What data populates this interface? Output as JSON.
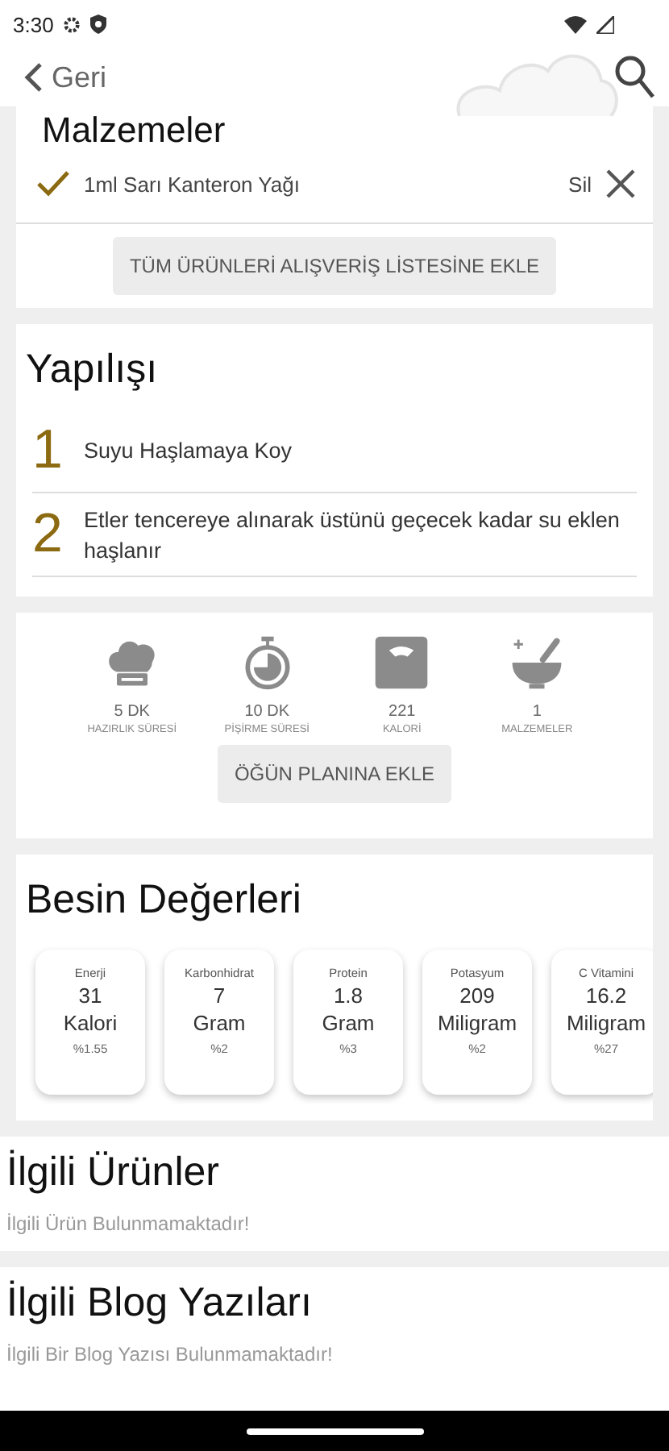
{
  "status_bar": {
    "time": "3:30"
  },
  "header": {
    "back_label": "Geri"
  },
  "ingredients": {
    "title": "Malzemeler",
    "items": [
      {
        "name": "1ml Sarı Kanteron Yağı",
        "checked": true,
        "remove_label": "Sil"
      }
    ],
    "add_all_button": "TÜM ÜRÜNLERİ ALIŞVERİŞ LİSTESİNE EKLE"
  },
  "steps": {
    "title": "Yapılışı",
    "items": [
      {
        "number": "1",
        "text": "Suyu Haşlamaya Koy"
      },
      {
        "number": "2",
        "text": "Etler tencereye alınarak üstünü geçecek kadar su eklen haşlanır"
      }
    ]
  },
  "stats": {
    "items": [
      {
        "kind": "chef",
        "value": "5 DK",
        "label": "HAZIRLIK SÜRESİ"
      },
      {
        "kind": "timer",
        "value": "10 DK",
        "label": "PİŞİRME SÜRESİ"
      },
      {
        "kind": "scale",
        "value": "221",
        "label": "KALORİ"
      },
      {
        "kind": "bowl",
        "value": "1",
        "label": "MALZEMELER"
      }
    ],
    "button": "ÖĞÜN PLANINA EKLE"
  },
  "nutrition": {
    "title": "Besin Değerleri",
    "items": [
      {
        "name": "Enerji",
        "amount": "31",
        "unit": "Kalori",
        "percent": "%1.55"
      },
      {
        "name": "Karbonhidrat",
        "amount": "7",
        "unit": "Gram",
        "percent": "%2"
      },
      {
        "name": "Protein",
        "amount": "1.8",
        "unit": "Gram",
        "percent": "%3"
      },
      {
        "name": "Potasyum",
        "amount": "209",
        "unit": "Miligram",
        "percent": "%2"
      },
      {
        "name": "C Vitamini",
        "amount": "16.2",
        "unit": "Miligram",
        "percent": "%27"
      }
    ]
  },
  "related_products": {
    "title": "İlgili Ürünler",
    "empty_text": "İlgili Ürün Bulunmamaktadır!"
  },
  "related_posts": {
    "title": "İlgili Blog Yazıları",
    "empty_text": "İlgili Bir Blog Yazısı Bulunmamaktadır!"
  }
}
